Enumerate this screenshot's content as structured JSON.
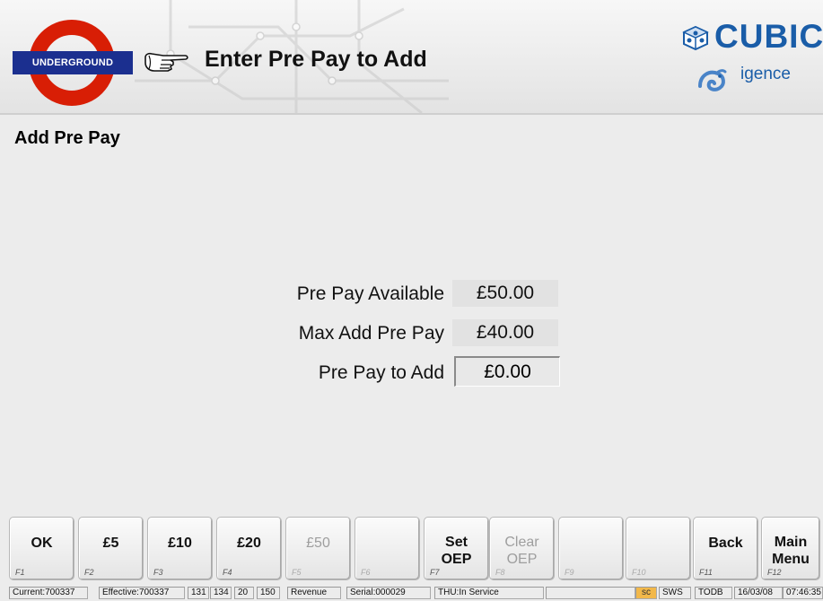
{
  "header": {
    "logo_text": "UNDERGROUND",
    "title": "Enter Pre Pay to Add",
    "brand_name": "CUBIC",
    "brand_sub": "igence"
  },
  "page": {
    "title": "Add Pre Pay"
  },
  "form": {
    "available_label": "Pre Pay Available",
    "available_value": "£50.00",
    "max_label": "Max Add Pre Pay",
    "max_value": "£40.00",
    "add_label": "Pre Pay to Add",
    "add_value": "£0.00"
  },
  "fkeys": [
    {
      "label": "OK",
      "key": "F1",
      "enabled": true
    },
    {
      "label": "£5",
      "key": "F2",
      "enabled": true
    },
    {
      "label": "£10",
      "key": "F3",
      "enabled": true
    },
    {
      "label": "£20",
      "key": "F4",
      "enabled": true
    },
    {
      "label": "£50",
      "key": "F5",
      "enabled": false
    },
    {
      "label": "",
      "key": "F6",
      "enabled": false
    },
    {
      "label_line1": "Set",
      "label_line2": "OEP",
      "key": "F7",
      "enabled": true
    },
    {
      "label_line1": "Clear",
      "label_line2": "OEP",
      "key": "F8",
      "enabled": false
    },
    {
      "label": "",
      "key": "F9",
      "enabled": false
    },
    {
      "label": "",
      "key": "F10",
      "enabled": false
    },
    {
      "label": "Back",
      "key": "F11",
      "enabled": true
    },
    {
      "label_line1": "Main",
      "label_line2": "Menu",
      "key": "F12",
      "enabled": true
    }
  ],
  "status": {
    "current": "Current:700337",
    "effective": "Effective:700337",
    "n1": "131",
    "n2": "134",
    "n3": "20",
    "n4": "150",
    "mode": "Revenue",
    "serial": "Serial:000029",
    "service": "THU:In Service",
    "sc": "sc",
    "sws": "SWS",
    "todb": "TODB",
    "date": "16/03/08",
    "time": "07:46:35"
  },
  "colors": {
    "roundel_red": "#d81e05",
    "roundel_blue": "#1b2f8f",
    "brand_blue": "#1a5da8",
    "status_highlight": "#f2b84a"
  }
}
